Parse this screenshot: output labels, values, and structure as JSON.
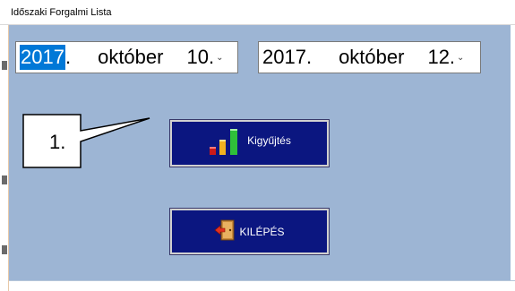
{
  "window": {
    "title": "Időszaki Forgalmi Lista"
  },
  "date_from": {
    "year": "2017",
    "dot": ".",
    "month": "október",
    "day": "10.",
    "chevron": "⌄"
  },
  "date_to": {
    "year": "2017.",
    "month": "október",
    "day": "12.",
    "chevron": "⌄"
  },
  "callout": {
    "label": "1."
  },
  "buttons": {
    "collect_label": "Kigyűjtés",
    "collect_icon": "bar-chart-icon",
    "exit_label": "KILÉPÉS",
    "exit_icon": "exit-door-icon"
  },
  "colors": {
    "client_background": "#9db5d4",
    "button_background": "#0b1680",
    "selection": "#0078d7"
  }
}
